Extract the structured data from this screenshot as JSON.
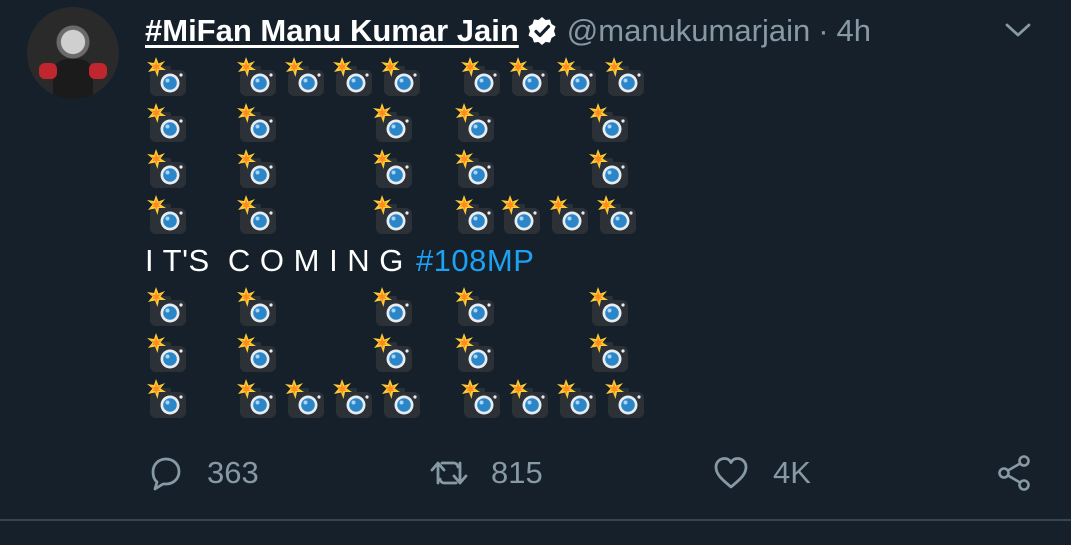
{
  "author": {
    "display_name": "#MiFan Manu Kumar Jain",
    "handle": "@manukumarjain",
    "separator": "·",
    "time": "4h",
    "verified": true
  },
  "tweet": {
    "emoji_name": "camera-with-flash-emoji",
    "text_line": "I T'S  C O M I N G",
    "hashtag": "#108MP"
  },
  "actions": {
    "replies": "363",
    "retweets": "815",
    "likes": "4K"
  },
  "colors": {
    "background": "#15202b",
    "text": "#ffffff",
    "secondary": "#8899a6",
    "link": "#1da1f2"
  },
  "icons": [
    "chevron-down-icon",
    "verified-badge-icon",
    "reply-icon",
    "retweet-icon",
    "like-icon",
    "share-icon"
  ]
}
